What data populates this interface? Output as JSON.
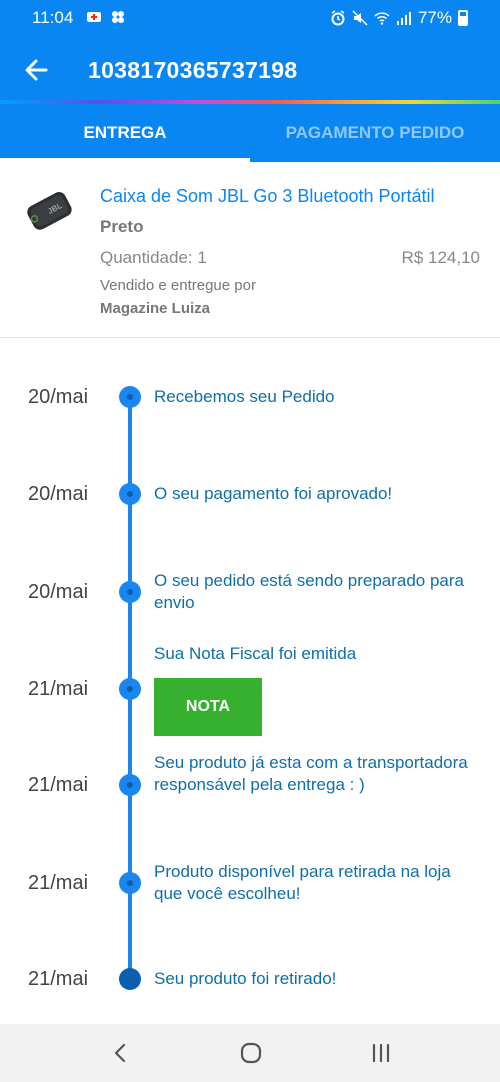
{
  "status_bar": {
    "time": "11:04",
    "battery_pct": "77%",
    "icons": [
      "notification-icon",
      "gallery-icon",
      "alarm-icon",
      "mute-icon",
      "wifi-icon",
      "signal-icon",
      "battery-icon"
    ]
  },
  "header": {
    "title": "1038170365737198",
    "back_icon": "arrow-left-icon"
  },
  "tabs": [
    {
      "label": "ENTREGA",
      "active": true
    },
    {
      "label": "PAGAMENTO PEDIDO",
      "active": false
    }
  ],
  "product": {
    "name": "Caixa de Som JBL Go 3 Bluetooth Portátil",
    "color": "Preto",
    "quantity": "Quantidade: 1",
    "price": "R$ 124,10",
    "seller_label": "Vendido e entregue por",
    "seller_name": "Magazine Luiza"
  },
  "timeline": [
    {
      "date": "20/mai",
      "text": "Recebemos seu Pedido"
    },
    {
      "date": "20/mai",
      "text": "O seu pagamento foi aprovado!"
    },
    {
      "date": "20/mai",
      "text": "O seu pedido está sendo preparado para envio"
    },
    {
      "date": "21/mai",
      "text": "Sua Nota Fiscal foi emitida",
      "button": "NOTA"
    },
    {
      "date": "21/mai",
      "text": "Seu produto já esta com a transportadora responsável pela entrega : )"
    },
    {
      "date": "21/mai",
      "text": "Produto disponível para retirada na loja que você escolheu!"
    },
    {
      "date": "21/mai",
      "text": "Seu produto foi retirado!"
    }
  ],
  "colors": {
    "primary": "#0a86f2",
    "timeline": "#1a87f0",
    "button_green": "#36b02e",
    "event_text": "#0e6fa8"
  },
  "nav": [
    "back-nav-icon",
    "home-nav-icon",
    "recents-nav-icon"
  ]
}
